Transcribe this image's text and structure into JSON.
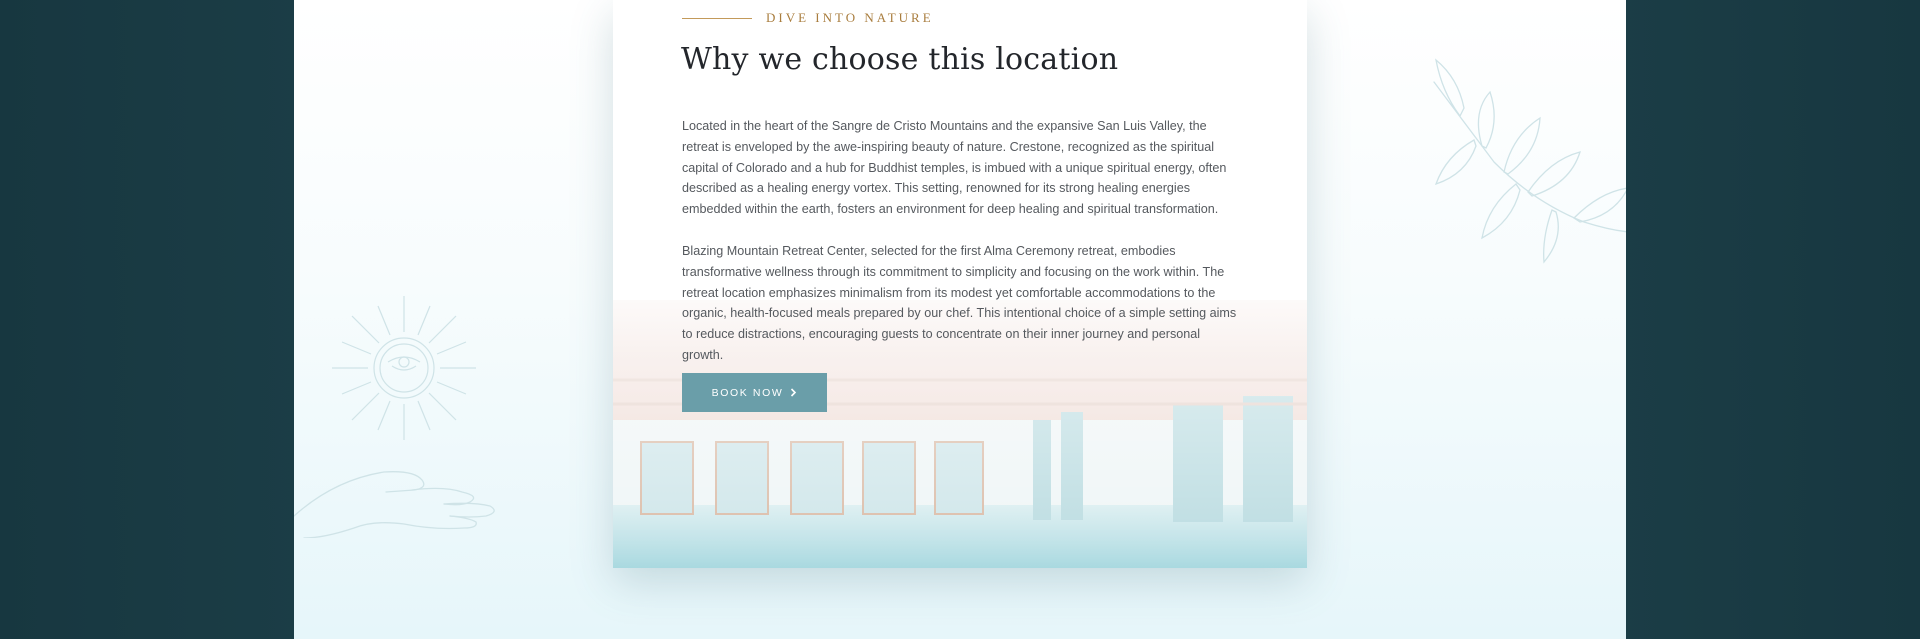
{
  "section": {
    "eyebrow": "DIVE INTO NATURE",
    "title": "Why we choose this location",
    "paragraphs": [
      "Located in the heart of the Sangre de Cristo Mountains and the expansive San Luis Valley, the retreat is enveloped by the awe-inspiring beauty of nature. Crestone, recognized as the spiritual capital of Colorado and a hub for Buddhist temples, is imbued with a unique spiritual energy, often described as a healing energy vortex. This setting, renowned for its strong healing energies embedded within the earth, fosters an environment for deep healing and spiritual transformation.",
      "Blazing Mountain Retreat Center, selected for the first Alma Ceremony retreat, embodies transformative wellness through its commitment to simplicity and focusing on the work within. The retreat location emphasizes minimalism from its modest yet comfortable accommodations to the organic, health-focused meals prepared by our chef. This intentional choice of a simple setting aims to reduce distractions, encouraging guests to concentrate on their inner journey and personal growth."
    ],
    "cta_label": "BOOK NOW",
    "cta_icon": "chevron-right-icon"
  },
  "decorations": {
    "sun_icon": "sun-eye-icon",
    "hand_icon": "open-hand-icon",
    "branch_icon": "leaf-branch-icon"
  },
  "colors": {
    "accent_gold": "#a97d3e",
    "button": "#6a9ea9",
    "outer_background": "#1f3f47",
    "title_text": "#23262b",
    "body_text": "#55595e"
  }
}
